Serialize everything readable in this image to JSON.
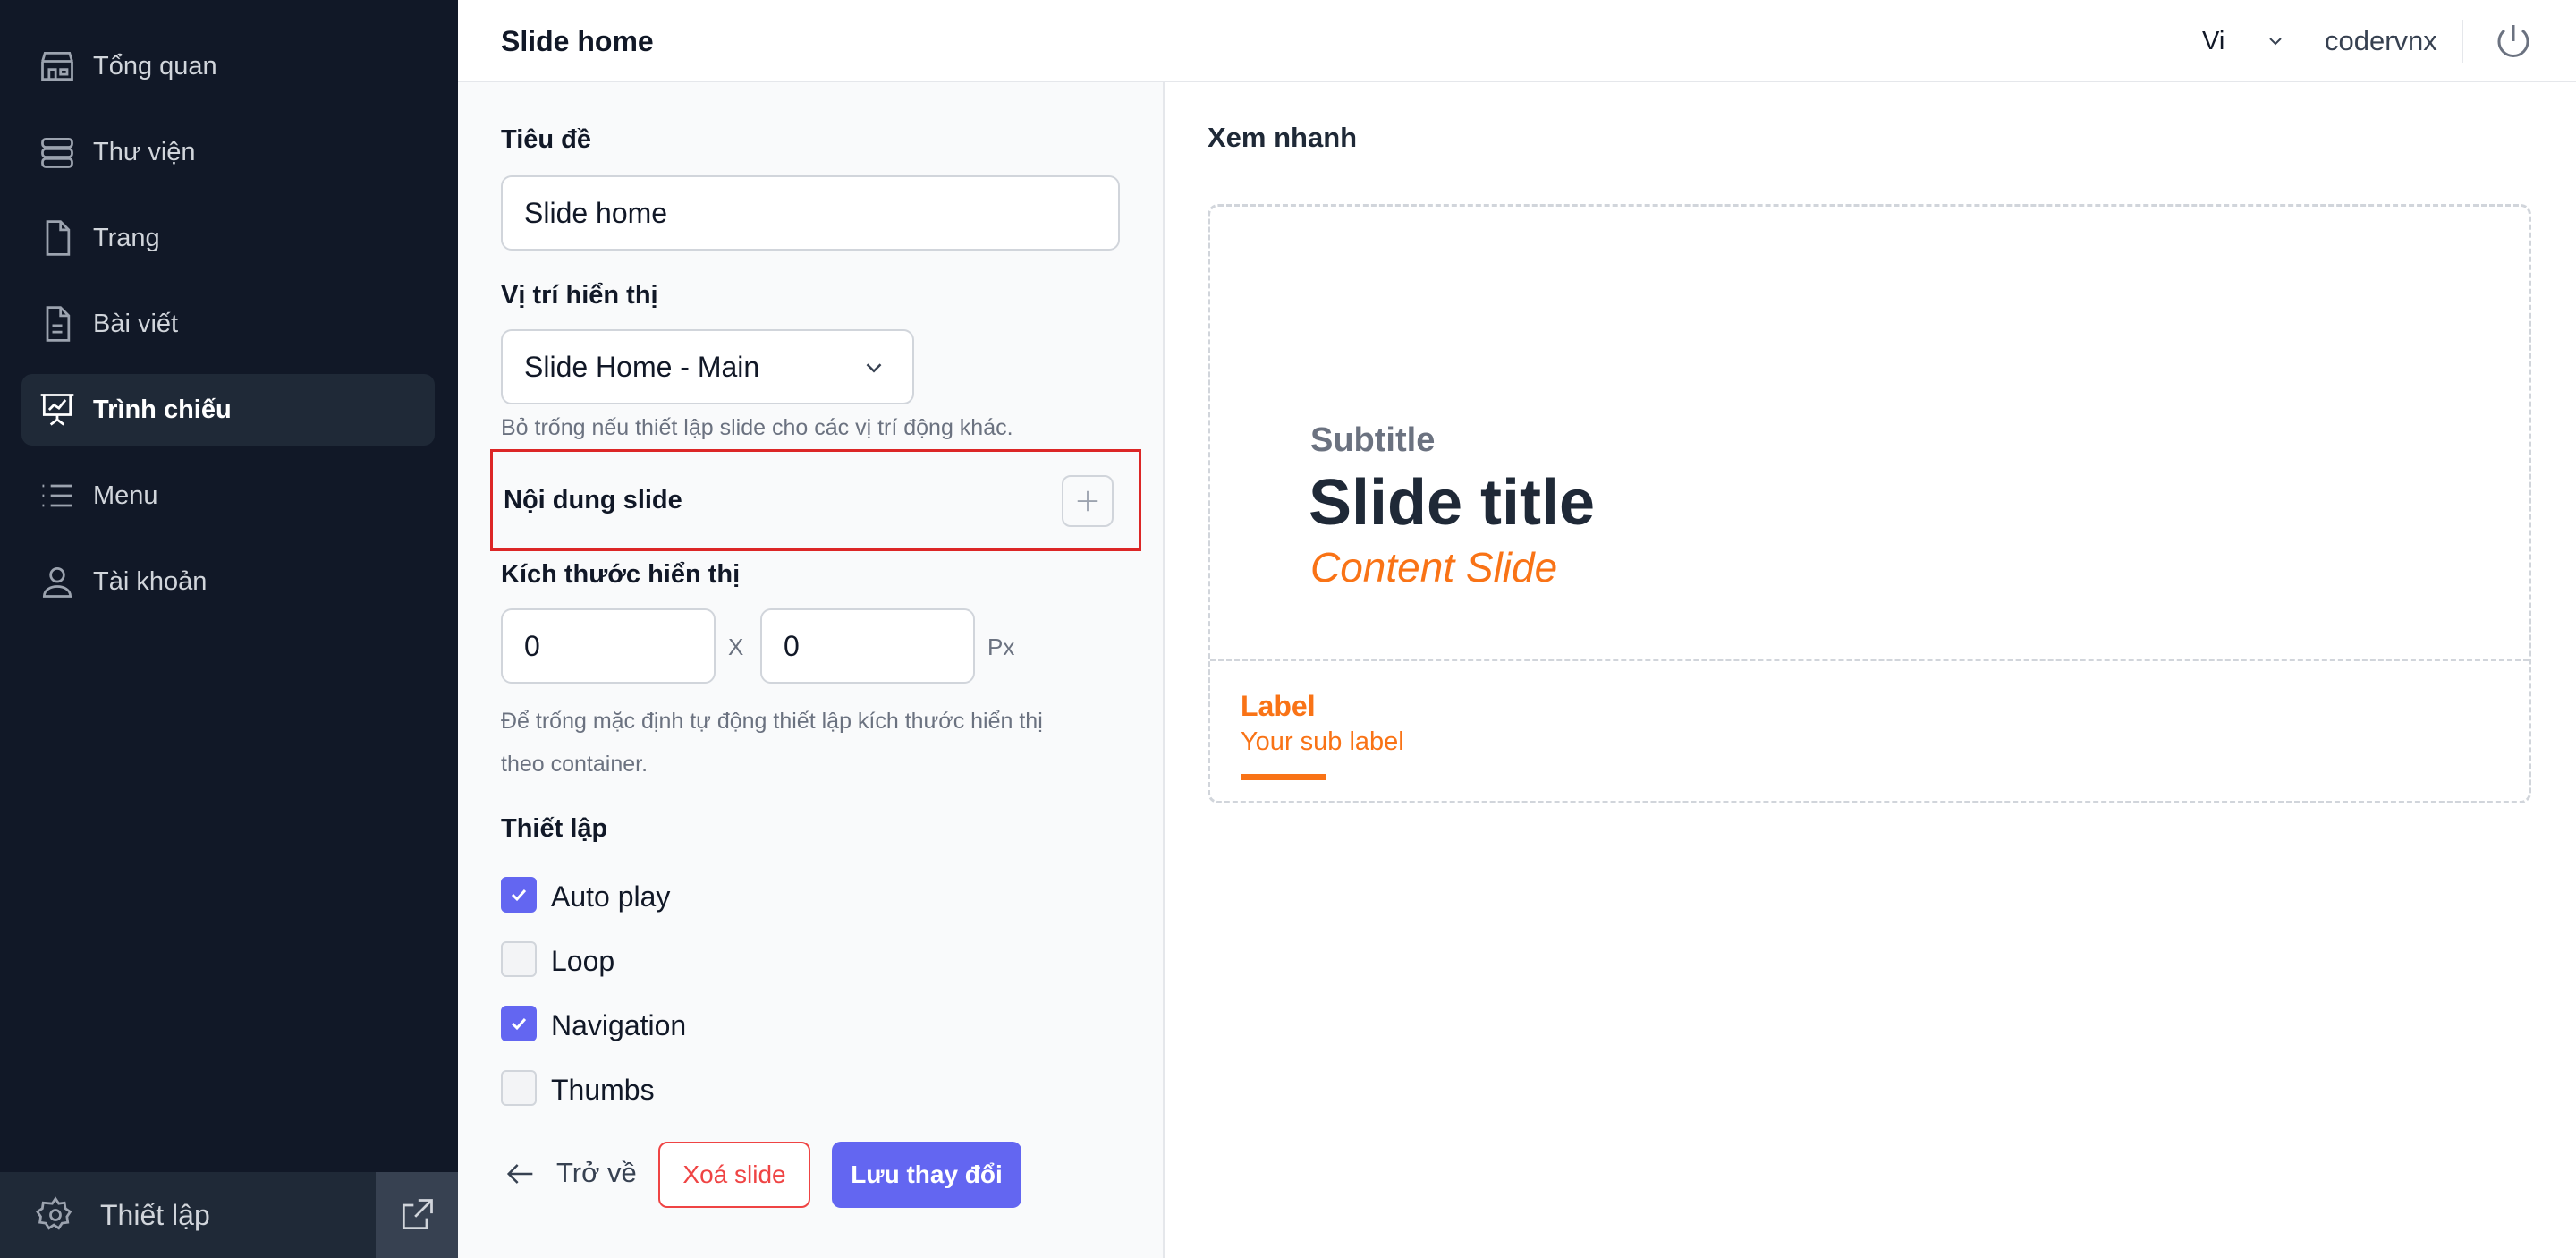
{
  "sidebar": {
    "items": [
      {
        "label": "Tổng quan",
        "icon": "store-icon",
        "active": false
      },
      {
        "label": "Thư viện",
        "icon": "stack-icon",
        "active": false
      },
      {
        "label": "Trang",
        "icon": "page-icon",
        "active": false
      },
      {
        "label": "Bài viết",
        "icon": "document-text-icon",
        "active": false
      },
      {
        "label": "Trình chiếu",
        "icon": "presentation-chart-icon",
        "active": true
      },
      {
        "label": "Menu",
        "icon": "list-icon",
        "active": false
      },
      {
        "label": "Tài khoản",
        "icon": "user-icon",
        "active": false
      }
    ],
    "footer": {
      "settings_label": "Thiết lập",
      "settings_icon": "gear-icon",
      "external_icon": "external-link-icon"
    }
  },
  "header": {
    "title": "Slide home",
    "language": "Vi",
    "username": "codervnx",
    "power_icon": "power-icon"
  },
  "form": {
    "title_label": "Tiêu đề",
    "title_value": "Slide home",
    "position_label": "Vị trí hiển thị",
    "position_value": "Slide Home - Main",
    "position_help": "Bỏ trống nếu thiết lập slide cho các vị trí động khác.",
    "content_label": "Nội dung slide",
    "size_label": "Kích thước hiển thị",
    "width_value": "0",
    "height_value": "0",
    "size_separator": "X",
    "size_unit": "Px",
    "size_help_line1": "Để trống mặc định tự động thiết lập kích thước hiển thị",
    "size_help_line2": "theo container.",
    "settings_label": "Thiết lập",
    "options": [
      {
        "label": "Auto play",
        "checked": true
      },
      {
        "label": "Loop",
        "checked": false
      },
      {
        "label": "Navigation",
        "checked": true
      },
      {
        "label": "Thumbs",
        "checked": false
      }
    ],
    "back_label": "Trở về",
    "delete_label": "Xoá slide",
    "save_label": "Lưu thay đổi"
  },
  "preview": {
    "title": "Xem nhanh",
    "slide_subtitle": "Subtitle",
    "slide_title": "Slide title",
    "slide_content": "Content Slide",
    "thumb_label": "Label",
    "thumb_sublabel": "Your sub label"
  },
  "colors": {
    "sidebar_bg": "#111827",
    "accent": "#6366f1",
    "danger": "#ef4444",
    "highlight_border": "#dc2626",
    "preview_accent": "#f97316"
  }
}
